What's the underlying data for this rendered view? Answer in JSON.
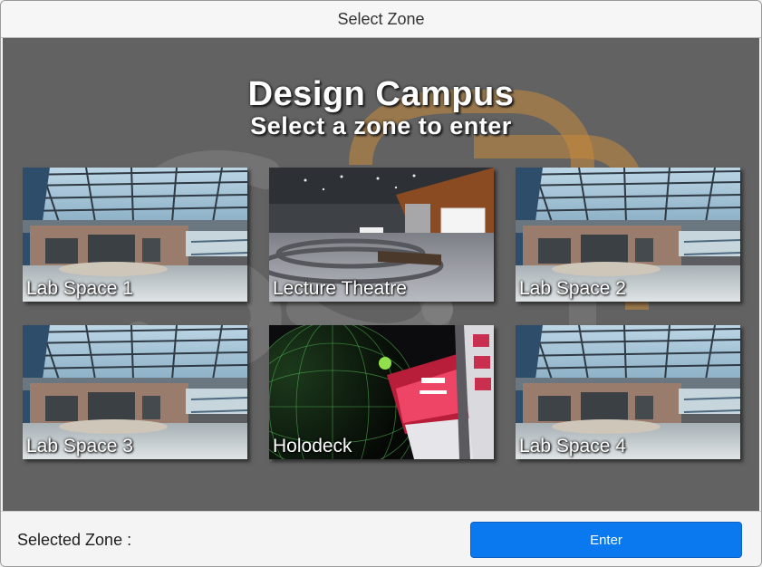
{
  "window": {
    "title": "Select Zone"
  },
  "header": {
    "title": "Design Campus",
    "subtitle": "Select a zone to enter"
  },
  "zones": [
    {
      "label": "Lab Space 1",
      "scene": "lab"
    },
    {
      "label": "Lecture Theatre",
      "scene": "theatre"
    },
    {
      "label": "Lab Space 2",
      "scene": "lab"
    },
    {
      "label": "Lab Space 3",
      "scene": "lab"
    },
    {
      "label": "Holodeck",
      "scene": "holodeck"
    },
    {
      "label": "Lab Space 4",
      "scene": "lab"
    }
  ],
  "footer": {
    "selected_label": "Selected Zone :",
    "enter_label": "Enter"
  },
  "colors": {
    "stage_bg": "#626262",
    "enter_button": "#0a79f0",
    "watermark_orange": "#c88a3c"
  }
}
